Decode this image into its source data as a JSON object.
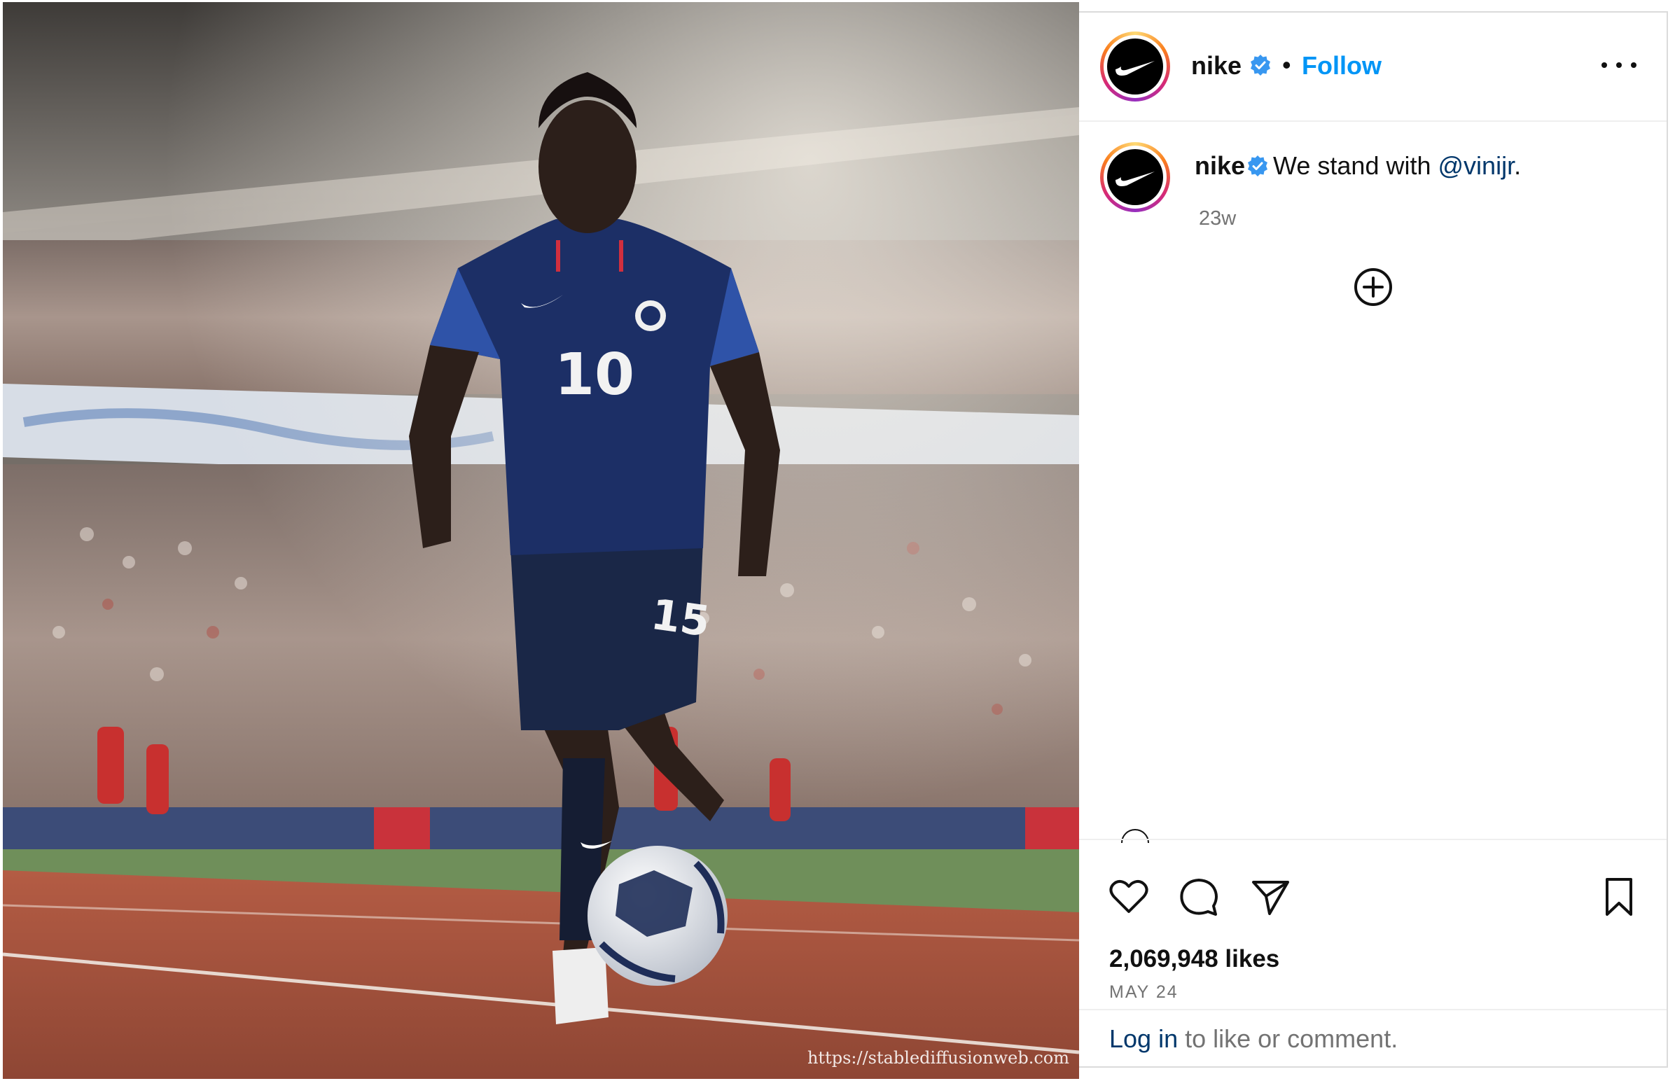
{
  "post": {
    "username": "nike",
    "follow_label": "Follow",
    "separator": "•",
    "caption_text": "We stand with",
    "caption_mention": "@vinijr",
    "caption_end": ".",
    "timestamp": "23w",
    "likes": "2,069,948 likes",
    "date": "MAY 24"
  },
  "image": {
    "watermark": "https://stablediffusionweb.com",
    "jersey_number": "10",
    "shorts_number": "15"
  },
  "footer": {
    "login_link": "Log in",
    "login_rest": " to like or comment."
  },
  "colors": {
    "accent": "#0095f6",
    "mention": "#00376b",
    "secondary_text": "#737373",
    "verified": "#3897f0"
  }
}
